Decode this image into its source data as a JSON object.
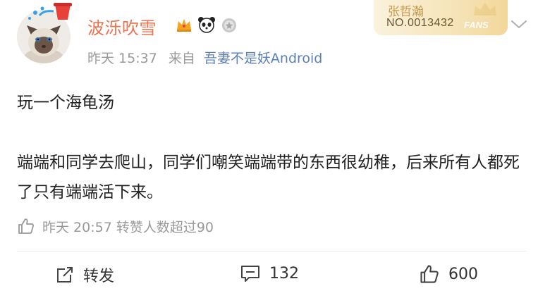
{
  "post": {
    "author": {
      "name": "波泺吹雪",
      "avatar_icon": "cat-avatar",
      "badges": [
        "crown-badge-icon",
        "panda-icon",
        "medal-icon"
      ]
    },
    "meta": {
      "time": "昨天 15:37",
      "from_label": "来自",
      "source": "吾妻不是妖Android"
    },
    "fans_card": {
      "name": "张哲瀚",
      "number": "NO.0013432",
      "label": "FANS",
      "background": "#f6e4b8"
    },
    "text": {
      "line1": "玩一个海龟汤",
      "paragraph": "端端和同学去爬山，同学们嘲笑端端带的东西很幼稚，后来所有人都死了只有端端活下来。"
    },
    "likes_summary": "昨天 20:57 转赞人数超过90",
    "actions": {
      "repost": "转发",
      "comments": "132",
      "likes": "600"
    },
    "colors": {
      "username": "#eb7350",
      "source_link": "#5b7fb8",
      "meta": "#999999"
    }
  }
}
